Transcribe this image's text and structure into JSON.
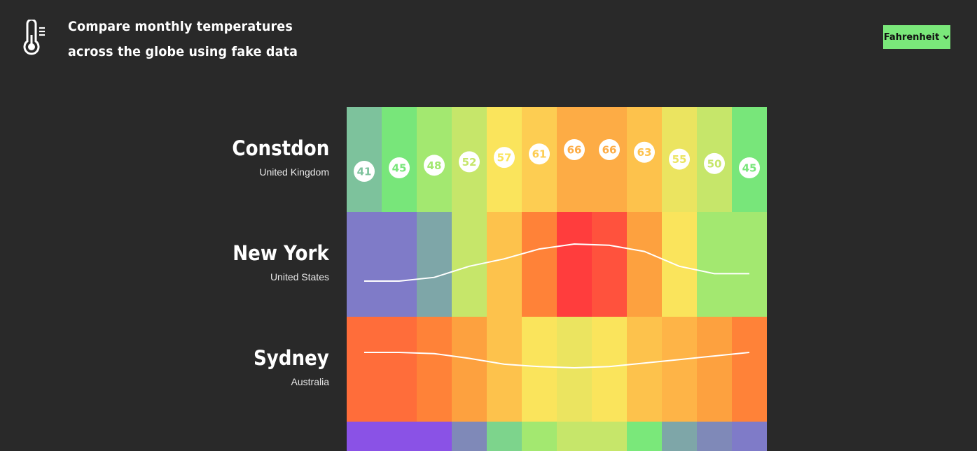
{
  "header": {
    "title_line1": "Compare monthly temperatures",
    "title_line2": "across the globe using fake data",
    "logo_icon": "thermometer-icon",
    "unit_select": {
      "selected": "Fahrenheit",
      "icon": "chevron-down-icon"
    }
  },
  "cities": [
    {
      "name": "Constdon",
      "country": "United Kingdom",
      "temps": [
        41,
        45,
        48,
        52,
        57,
        61,
        66,
        66,
        63,
        55,
        50,
        45
      ],
      "colors": [
        "#7dc29c",
        "#78e67a",
        "#a3e870",
        "#c6e66a",
        "#fae45c",
        "#fdcd52",
        "#fdac45",
        "#fdac45",
        "#fdc24c",
        "#ebe460",
        "#c6e66a",
        "#78e67a"
      ],
      "display": "badges"
    },
    {
      "name": "New York",
      "country": "United States",
      "temps": [
        29,
        29,
        32,
        41,
        47,
        55,
        59,
        58,
        53,
        41,
        35,
        35
      ],
      "colors": [
        "#7f7bc8",
        "#7f7bc8",
        "#7ea6a8",
        "#c6e66a",
        "#fdc24c",
        "#ff8238",
        "#ff3d3d",
        "#ff523d",
        "#fda13f",
        "#fae45c",
        "#a3e870",
        "#a3e870"
      ],
      "display": "line"
    },
    {
      "name": "Sydney",
      "country": "Australia",
      "temps": [
        72,
        72,
        71,
        67,
        62,
        60,
        59,
        60,
        63,
        66,
        69,
        72
      ],
      "colors": [
        "#ff6d3a",
        "#ff6d3a",
        "#ff8238",
        "#fda13f",
        "#fdc24c",
        "#fae45c",
        "#ebe460",
        "#fae45c",
        "#fdc24c",
        "#feb447",
        "#fda13f",
        "#ff8238"
      ],
      "display": "line"
    },
    {
      "name": "",
      "country": "",
      "temps": [],
      "colors": [
        "#8a52e6",
        "#8a52e6",
        "#8a52e6",
        "#7f89b8",
        "#7dd48c",
        "#a3e870",
        "#c6e66a",
        "#c6e66a",
        "#7ae87a",
        "#7ea6a8",
        "#7f89b8",
        "#7f7bc8"
      ],
      "display": "partial"
    }
  ]
}
